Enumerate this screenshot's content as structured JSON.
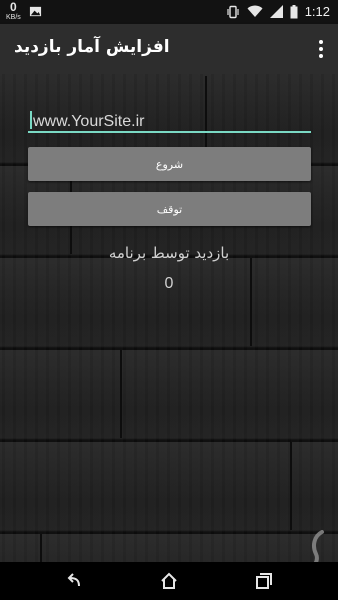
{
  "status_bar": {
    "net_speed_value": "0",
    "net_speed_unit": "KB/s",
    "time": "1:12"
  },
  "app": {
    "title": "افزایش آمار بازدید"
  },
  "form": {
    "url_value": "www.YourSite.ir",
    "start_label": "شروع",
    "stop_label": "توقف"
  },
  "stats": {
    "label": "بازدید توسط برنامه",
    "count": "0"
  },
  "icons": {
    "status_left": [
      "image-icon"
    ],
    "status_right": [
      "vibrate-icon",
      "wifi-icon",
      "signal-icon",
      "battery-icon"
    ],
    "navigation": [
      "back-icon",
      "home-icon",
      "recent-apps-icon"
    ],
    "action_bar": "overflow-menu-icon"
  },
  "colors": {
    "accent": "#7ad9c4",
    "button": "#7d7d7d",
    "action_bar": "#2d2d2d"
  }
}
